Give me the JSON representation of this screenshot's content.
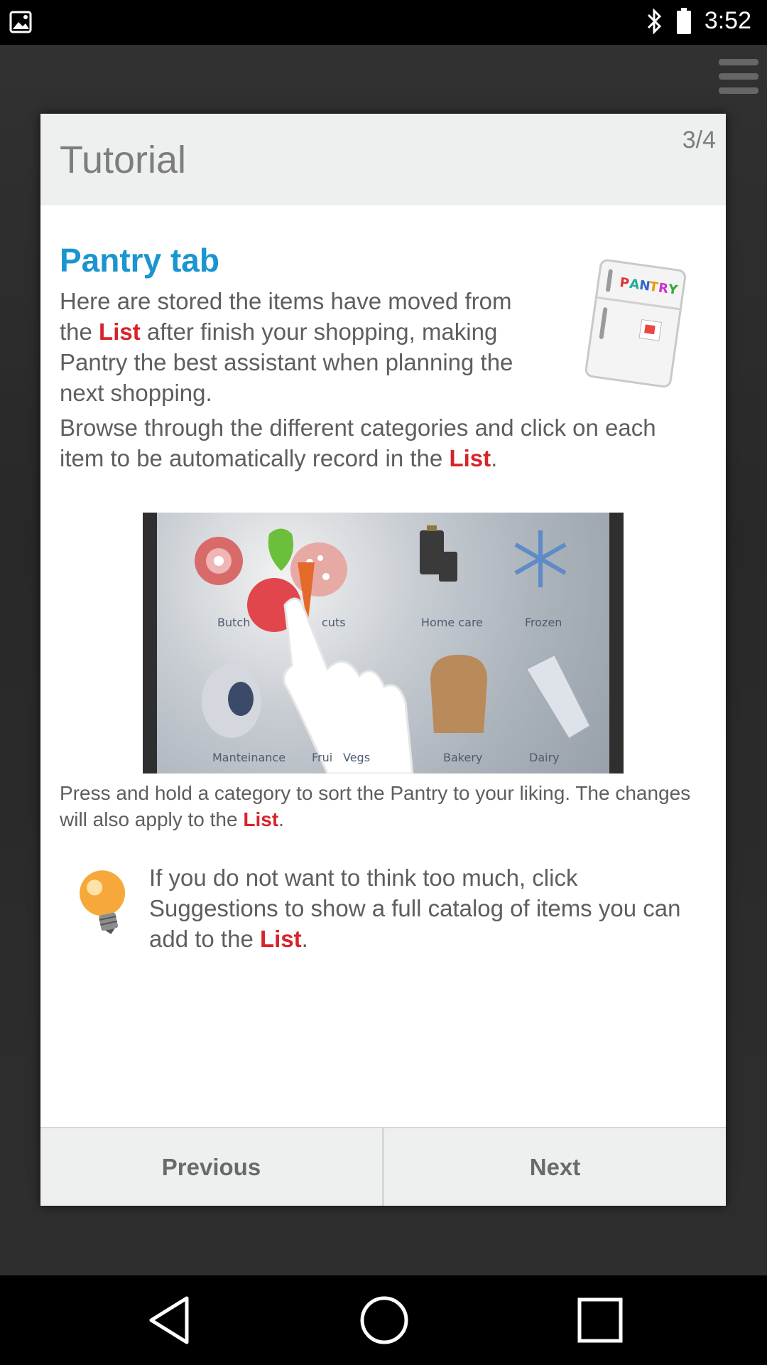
{
  "status_bar": {
    "time": "3:52",
    "icons": [
      "photo-icon",
      "bluetooth-icon",
      "battery-icon"
    ]
  },
  "dialog": {
    "title": "Tutorial",
    "page_indicator": "3/4",
    "section_title": "Pantry tab",
    "paragraph1": {
      "a": "Here are stored the items have moved from the ",
      "b": "List",
      "c": " after finish your shopping, making Pantry the best assistant when planning the next shopping."
    },
    "paragraph2": {
      "a": "Browse through the different categories and click on each item to be automatically record in the ",
      "b": "List",
      "c": "."
    },
    "paragraph3": {
      "a": "Press and hold a category to sort the Pantry to your liking. The changes will also apply to the ",
      "b": "List",
      "c": "."
    },
    "paragraph4": {
      "a": "If you do not want to think too much, click Suggestions to show a full catalog of items you can add to the ",
      "b": "List",
      "c": "."
    },
    "fridge_label": "PANTRY",
    "screenshot_categories": [
      "Butch",
      "cuts",
      "Home care",
      "Frozen",
      "Manteinance",
      "Frui",
      "Vegs",
      "Bakery",
      "Dairy"
    ],
    "previous_label": "Previous",
    "next_label": "Next"
  },
  "colors": {
    "accent_blue": "#1a95cf",
    "highlight_red": "#d8232a",
    "text_gray": "#5e5e5e"
  }
}
